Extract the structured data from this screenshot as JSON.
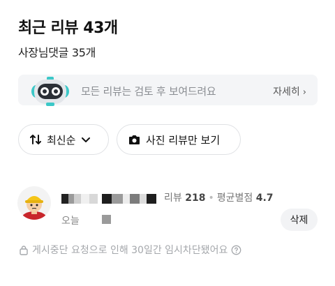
{
  "header": {
    "title": "최근 리뷰 43개",
    "subtitle": "사장님댓글 35개"
  },
  "notice": {
    "icon": "robot-icon",
    "text": "모든 리뷰는 검토 후 보여드려요",
    "more_label": "자세히"
  },
  "filters": {
    "sort_label": "최신순",
    "photo_only_label": "사진 리뷰만 보기"
  },
  "review": {
    "stats_label_1": "리뷰",
    "review_count": "218",
    "stats_label_2": "평균별점",
    "avg_rating": "4.7",
    "date_text": "오늘",
    "delete_label": "삭제",
    "blocked_message": "게시중단 요청으로 인해 30일간 임시차단됐어요"
  },
  "colors": {
    "accent_teal": "#3cc8c8",
    "notice_bg": "#f4f5f7",
    "muted_text": "#a4a7ab"
  }
}
